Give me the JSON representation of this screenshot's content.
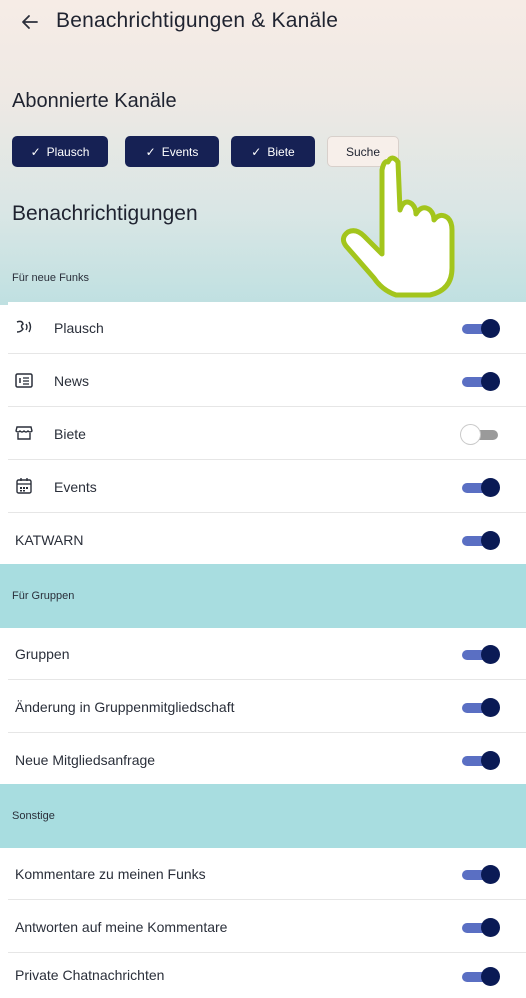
{
  "header": {
    "title": "Benachrichtigungen & Kanäle"
  },
  "subscribed": {
    "heading": "Abonnierte Kanäle",
    "chips": [
      {
        "label": "Plausch",
        "selected": true
      },
      {
        "label": "Events",
        "selected": true
      },
      {
        "label": "Biete",
        "selected": true
      },
      {
        "label": "Suche",
        "selected": false
      }
    ]
  },
  "notifications": {
    "heading": "Benachrichtigungen",
    "groups": [
      {
        "label": "Für neue Funks",
        "items": [
          {
            "label": "Plausch",
            "icon": "chat-sound-icon",
            "on": true
          },
          {
            "label": "News",
            "icon": "news-icon",
            "on": true
          },
          {
            "label": "Biete",
            "icon": "store-icon",
            "on": false
          },
          {
            "label": "Events",
            "icon": "calendar-icon",
            "on": true
          },
          {
            "label": "KATWARN",
            "icon": "",
            "on": true
          }
        ]
      },
      {
        "label": "Für Gruppen",
        "items": [
          {
            "label": "Gruppen",
            "on": true
          },
          {
            "label": "Änderung in Gruppenmitgliedschaft",
            "on": true
          },
          {
            "label": "Neue Mitgliedsanfrage",
            "on": true
          }
        ]
      },
      {
        "label": "Sonstige",
        "items": [
          {
            "label": "Kommentare zu meinen Funks",
            "on": true
          },
          {
            "label": "Antworten auf meine Kommentare",
            "on": true
          },
          {
            "label": "Private Chatnachrichten",
            "on": true
          }
        ]
      }
    ]
  },
  "colors": {
    "chip_selected": "#162154",
    "toggle_on": "#0a1a55",
    "section_teal": "#a8dde0",
    "cursor_outline": "#a3c51c"
  }
}
